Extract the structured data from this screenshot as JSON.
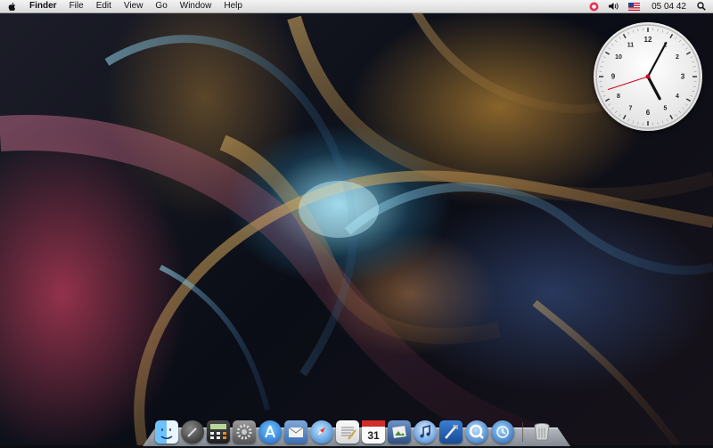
{
  "menubar": {
    "apple_icon": "apple-icon",
    "app_name": "Finder",
    "menus": [
      "File",
      "Edit",
      "View",
      "Go",
      "Window",
      "Help"
    ],
    "status_icons": [
      "status-app-icon",
      "volume-icon",
      "us-flag-icon"
    ],
    "clock": "05 04 42",
    "search_icon": "spotlight-search-icon"
  },
  "clock_widget": {
    "numbers": [
      "12",
      "1",
      "2",
      "3",
      "4",
      "5",
      "6",
      "7",
      "8",
      "9",
      "10",
      "11"
    ],
    "time": {
      "hours": 5,
      "minutes": 4,
      "seconds": 42
    }
  },
  "dock": {
    "apps": [
      "finder-icon",
      "dashboard-icon",
      "calculator-icon",
      "system-preferences-icon",
      "app-store-icon",
      "mail-icon",
      "safari-icon",
      "textedit-icon",
      "ical-icon",
      "iphoto-icon",
      "itunes-icon",
      "xcode-icon",
      "quicktime-icon",
      "trash-icon"
    ],
    "ical_date": "31"
  },
  "colors": {
    "menubar": "#e6e6e6",
    "second_hand": "#d0021b",
    "clock_hand": "#111111"
  }
}
